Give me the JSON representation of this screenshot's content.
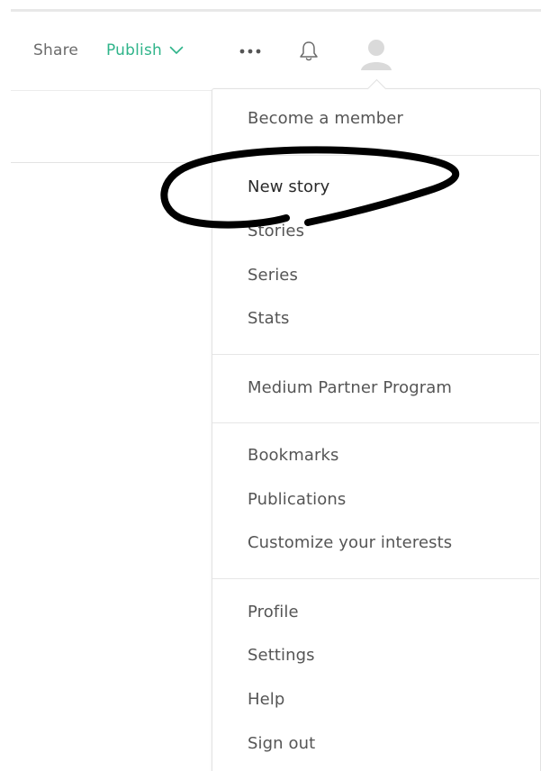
{
  "header": {
    "share_label": "Share",
    "publish_label": "Publish",
    "accent_color": "#2fb48a",
    "icons": [
      "chevron-down-icon",
      "more-icon",
      "bell-icon",
      "avatar-icon"
    ]
  },
  "menu": {
    "groups": [
      {
        "items": [
          "Become a member"
        ]
      },
      {
        "items": [
          "New story",
          "Stories",
          "Series",
          "Stats"
        ]
      },
      {
        "items": [
          "Medium Partner Program"
        ]
      },
      {
        "items": [
          "Bookmarks",
          "Publications",
          "Customize your interests"
        ]
      },
      {
        "items": [
          "Profile",
          "Settings",
          "Help",
          "Sign out"
        ]
      }
    ]
  }
}
